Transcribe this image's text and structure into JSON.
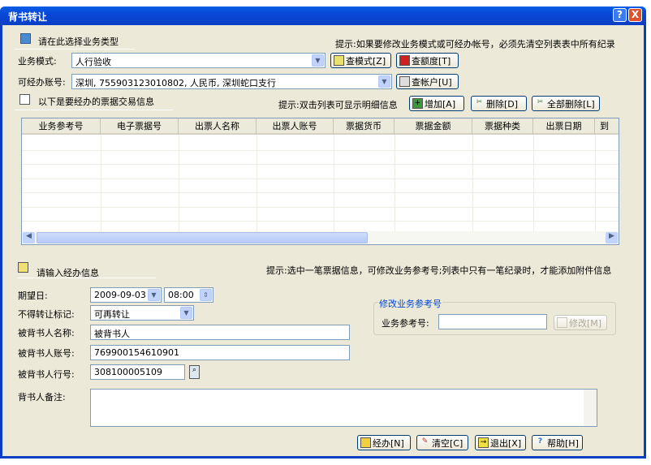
{
  "window": {
    "title": "背书转让",
    "help_button": "?",
    "close_button": "X"
  },
  "section_business": {
    "header": "请在此选择业务类型",
    "hint": "提示:如果要修改业务模式或可经办帐号，必须先清空列表表中所有纪录",
    "mode_label": "业务模式:",
    "mode_value": "人行验收",
    "query_mode_button": "查模式[Z]",
    "query_limit_button": "查额度[T]",
    "account_label": "可经办账号:",
    "account_value": "深圳, 755903123010802, 人民币, 深圳蛇口支行",
    "query_account_button": "查帐户[U]"
  },
  "section_bills": {
    "header": "以下是要经办的票据交易信息",
    "hint": "提示:双击列表可显示明细信息",
    "add_button": "增加[A]",
    "delete_button": "删除[D]",
    "delete_all_button": "全部删除[L]",
    "columns": [
      "业务参考号",
      "电子票据号",
      "出票人名称",
      "出票人账号",
      "票据货币",
      "票据金额",
      "票据种类",
      "出票日期",
      "到"
    ]
  },
  "section_handle": {
    "header": "请输入经办信息",
    "hint": "提示:选中一笔票据信息，可修改业务参考号;列表中只有一笔纪录时，才能添加附件信息",
    "expected_date_label": "期望日:",
    "expected_date": "2009-09-03",
    "expected_time": "08:00",
    "no_transfer_label": "不得转让标记:",
    "no_transfer_value": "可再转让",
    "endorsee_name_label": "被背书人名称:",
    "endorsee_name": "被背书人",
    "endorsee_account_label": "被背书人账号:",
    "endorsee_account": "769900154610901",
    "endorsee_bank_label": "被背书人行号:",
    "endorsee_bank": "308100005109",
    "remark_label": "背书人备注:",
    "remark": ""
  },
  "modify_ref": {
    "legend": "修改业务参考号",
    "ref_label": "业务参考号:",
    "ref_value": "",
    "modify_button": "修改[M]"
  },
  "footer": {
    "handle_button": "经办[N]",
    "clear_button": "清空[C]",
    "exit_button": "退出[X]",
    "help_button": "帮助[H]"
  }
}
